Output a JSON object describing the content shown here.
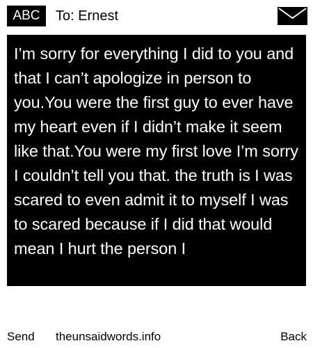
{
  "header": {
    "badge": "ABC",
    "to": "To: Ernest",
    "icon": "envelope-icon"
  },
  "message": {
    "text": "I’m sorry for everything I did to you and that I can’t apologize in person to you.You were the first guy to ever have my heart even if I didn’t make it seem like that.You were my first love I’m sorry I couldn’t tell you that. the truth is I was scared to even admit it to myself I was to scared because if I did that would mean I hurt the person I"
  },
  "footer": {
    "send": "Send",
    "site": "theunsaidwords.info",
    "back": "Back"
  },
  "colors": {
    "background": "#ffffff",
    "panel": "#000000",
    "panel_text": "#ffffff"
  }
}
